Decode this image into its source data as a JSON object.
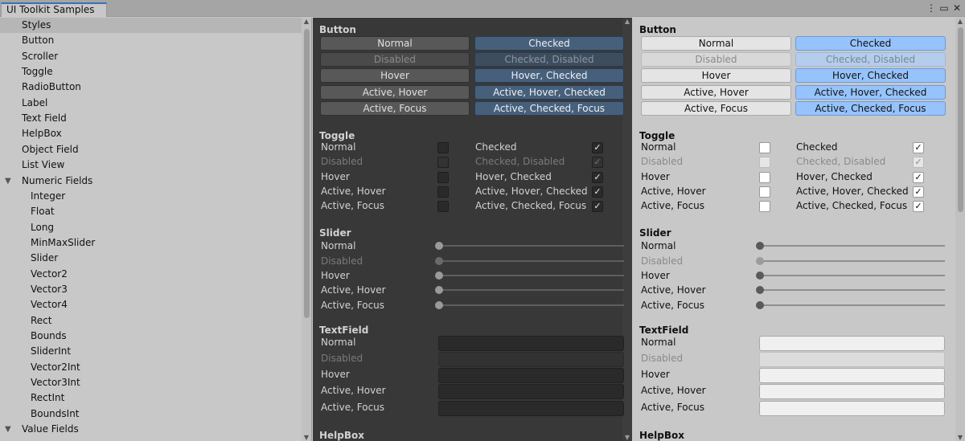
{
  "window": {
    "tab_title": "UI Toolkit Samples",
    "icons": [
      "more-icon",
      "maximize-icon",
      "close-icon"
    ]
  },
  "sidebar": {
    "items": [
      {
        "label": "Styles",
        "indent": 0,
        "selected": true
      },
      {
        "label": "Button",
        "indent": 0
      },
      {
        "label": "Scroller",
        "indent": 0
      },
      {
        "label": "Toggle",
        "indent": 0
      },
      {
        "label": "RadioButton",
        "indent": 0
      },
      {
        "label": "Label",
        "indent": 0
      },
      {
        "label": "Text Field",
        "indent": 0
      },
      {
        "label": "HelpBox",
        "indent": 0
      },
      {
        "label": "Object Field",
        "indent": 0
      },
      {
        "label": "List View",
        "indent": 0
      },
      {
        "label": "Numeric Fields",
        "indent": 0,
        "expanded": true
      },
      {
        "label": "Integer",
        "indent": 1
      },
      {
        "label": "Float",
        "indent": 1
      },
      {
        "label": "Long",
        "indent": 1
      },
      {
        "label": "MinMaxSlider",
        "indent": 1
      },
      {
        "label": "Slider",
        "indent": 1
      },
      {
        "label": "Vector2",
        "indent": 1
      },
      {
        "label": "Vector3",
        "indent": 1
      },
      {
        "label": "Vector4",
        "indent": 1
      },
      {
        "label": "Rect",
        "indent": 1
      },
      {
        "label": "Bounds",
        "indent": 1
      },
      {
        "label": "SliderInt",
        "indent": 1
      },
      {
        "label": "Vector2Int",
        "indent": 1
      },
      {
        "label": "Vector3Int",
        "indent": 1
      },
      {
        "label": "RectInt",
        "indent": 1
      },
      {
        "label": "BoundsInt",
        "indent": 1
      },
      {
        "label": "Value Fields",
        "indent": 0,
        "expanded": true
      }
    ]
  },
  "sections": {
    "button": "Button",
    "toggle": "Toggle",
    "slider": "Slider",
    "textfield": "TextField",
    "helpbox": "HelpBox"
  },
  "buttons": {
    "left": [
      "Normal",
      "Disabled",
      "Hover",
      "Active, Hover",
      "Active, Focus"
    ],
    "right": [
      "Checked",
      "Checked, Disabled",
      "Hover, Checked",
      "Active, Hover, Checked",
      "Active, Checked, Focus"
    ]
  },
  "toggles": {
    "left": [
      "Normal",
      "Disabled",
      "Hover",
      "Active, Hover",
      "Active, Focus"
    ],
    "right": [
      "Checked",
      "Checked, Disabled",
      "Hover, Checked",
      "Active, Hover, Checked",
      "Active, Checked, Focus"
    ],
    "check_glyph": "✓"
  },
  "sliders": {
    "labels": [
      "Normal",
      "Disabled",
      "Hover",
      "Active, Hover",
      "Active, Focus"
    ],
    "value": 0
  },
  "textfields": {
    "labels": [
      "Normal",
      "Disabled",
      "Hover",
      "Active, Hover",
      "Active, Focus"
    ]
  },
  "colors": {
    "dark_bg": "#383838",
    "light_bg": "#c8c8c8",
    "dark_checked": "#46607c",
    "light_checked": "#96c3fb",
    "tab_accent": "#3a72b0"
  }
}
